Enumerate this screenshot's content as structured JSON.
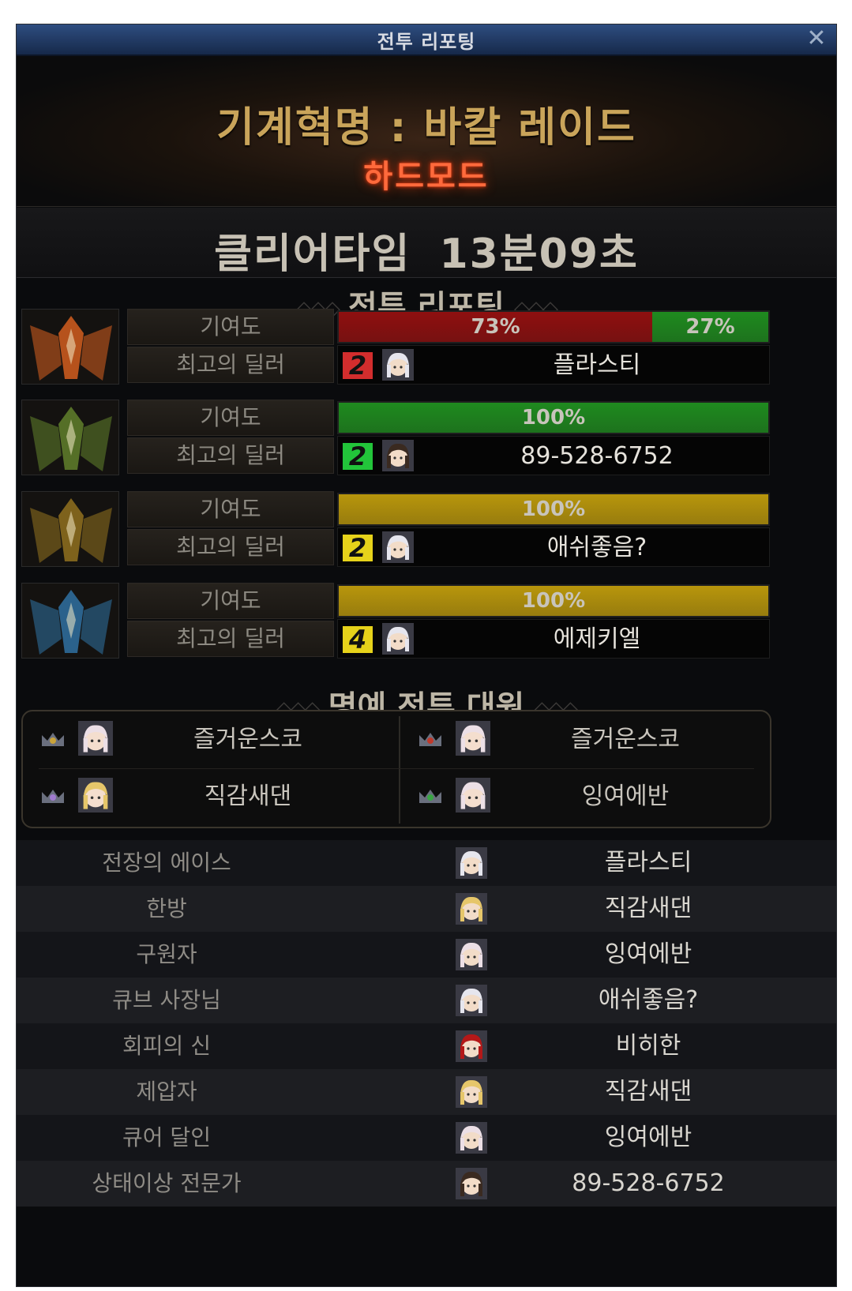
{
  "window": {
    "title": "전투 리포팅",
    "close_glyph": "✕"
  },
  "raid": {
    "name": "기계혁명 : 바칼 레이드",
    "mode": "하드모드"
  },
  "clear": {
    "label": "클리어타임",
    "time": "13분09초"
  },
  "reporting": {
    "title": "전투 리포팅",
    "contribution_label": "기여도",
    "best_dealer_label": "최고의 딜러",
    "bosses": [
      {
        "icon": "fire-dragon-boss-icon",
        "theme": "#c85a1e",
        "segments": [
          {
            "label": "73%",
            "value": 73,
            "color": "#8f1010"
          },
          {
            "label": "27%",
            "value": 27,
            "color": "#1f8a1f"
          }
        ],
        "dealer": {
          "rank": "2",
          "rank_color": "#d22d2d",
          "name": "플라스티"
        }
      },
      {
        "icon": "wind-dragon-boss-icon",
        "theme": "#5c7a2a",
        "segments": [
          {
            "label": "100%",
            "value": 100,
            "color": "#1f8a1f"
          }
        ],
        "dealer": {
          "rank": "2",
          "rank_color": "#22c53a",
          "name": "89-528-6752"
        }
      },
      {
        "icon": "earth-dragon-boss-icon",
        "theme": "#8a6c1e",
        "segments": [
          {
            "label": "100%",
            "value": 100,
            "color": "#b8960c"
          }
        ],
        "dealer": {
          "rank": "2",
          "rank_color": "#e6d21a",
          "name": "애쉬좋음?"
        }
      },
      {
        "icon": "ice-dragon-boss-icon",
        "theme": "#2d6c9a",
        "segments": [
          {
            "label": "100%",
            "value": 100,
            "color": "#b8960c"
          }
        ],
        "dealer": {
          "rank": "4",
          "rank_color": "#e6d21a",
          "name": "에제키엘"
        }
      }
    ]
  },
  "honor": {
    "title": "명예 전투 대원",
    "members": [
      {
        "name": "즐거운스코",
        "crown": "#c9a33a"
      },
      {
        "name": "즐거운스코",
        "crown": "#c0392b"
      },
      {
        "name": "직감새댄",
        "crown": "#a07bd0"
      },
      {
        "name": "잉여에반",
        "crown": "#3aa544"
      }
    ]
  },
  "awards": [
    {
      "title": "전장의 에이스",
      "name": "플라스티"
    },
    {
      "title": "한방",
      "name": "직감새댄"
    },
    {
      "title": "구원자",
      "name": "잉여에반"
    },
    {
      "title": "큐브 사장님",
      "name": "애쉬좋음?"
    },
    {
      "title": "회피의 신",
      "name": "비히한"
    },
    {
      "title": "제압자",
      "name": "직감새댄"
    },
    {
      "title": "큐어 달인",
      "name": "잉여에반"
    },
    {
      "title": "상태이상 전문가",
      "name": "89-528-6752"
    }
  ]
}
